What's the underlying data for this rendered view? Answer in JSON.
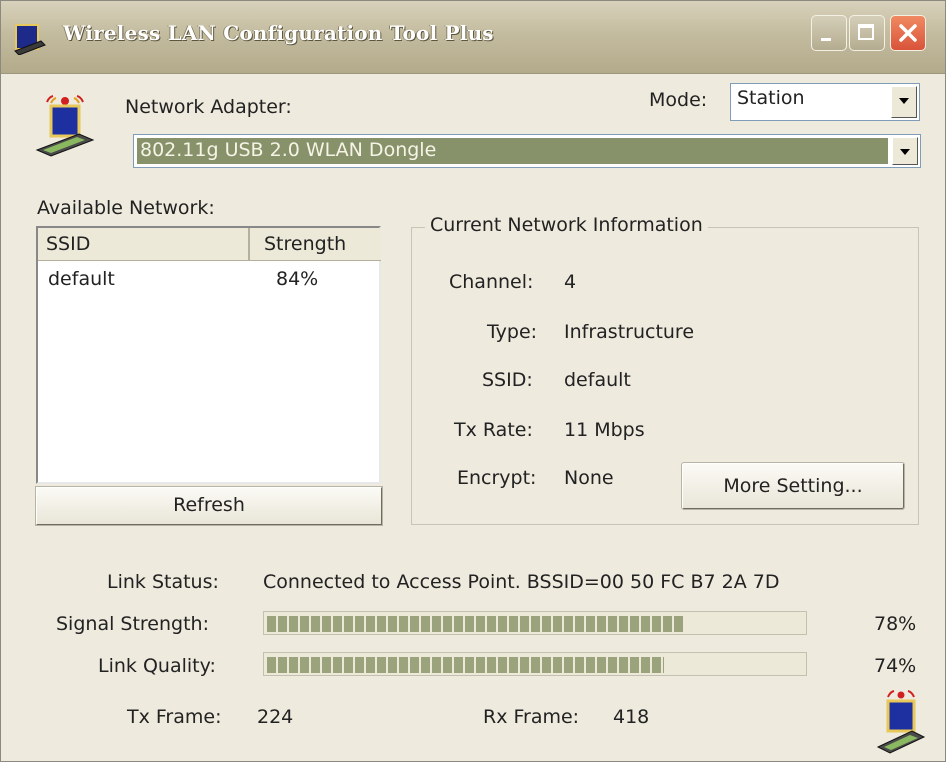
{
  "window": {
    "title": "Wireless LAN Configuration Tool Plus"
  },
  "adapter": {
    "label": "Network Adapter:",
    "selected": "802.11g USB 2.0 WLAN Dongle"
  },
  "mode": {
    "label": "Mode:",
    "selected": "Station"
  },
  "available_network": {
    "label": "Available Network:",
    "columns": [
      "SSID",
      "Strength"
    ],
    "rows": [
      {
        "ssid": "default",
        "strength": "84%"
      }
    ],
    "refresh_label": "Refresh"
  },
  "current_info": {
    "title": "Current Network Information",
    "channel_label": "Channel:",
    "channel": "4",
    "type_label": "Type:",
    "type": "Infrastructure",
    "ssid_label": "SSID:",
    "ssid": "default",
    "txrate_label": "Tx Rate:",
    "txrate": "11 Mbps",
    "encrypt_label": "Encrypt:",
    "encrypt": "None",
    "more_label": "More Setting..."
  },
  "status": {
    "link_status_label": "Link Status:",
    "link_status": "Connected to Access Point. BSSID=00 50 FC B7 2A 7D",
    "signal_label": "Signal Strength:",
    "signal_text": "78%",
    "signal_value": 0.78,
    "quality_label": "Link Quality:",
    "quality_text": "74%",
    "quality_value": 0.74,
    "tx_frame_label": "Tx Frame:",
    "tx_frame": "224",
    "rx_frame_label": "Rx Frame:",
    "rx_frame": "418"
  },
  "colors": {
    "bar_fill": "#9aa37b",
    "window_bg": "#eeeade",
    "adapter_field": "#87916a"
  },
  "icons": {
    "app": "wireless-laptop-icon",
    "adapter": "wireless-laptop-icon",
    "tray": "wireless-laptop-icon"
  }
}
